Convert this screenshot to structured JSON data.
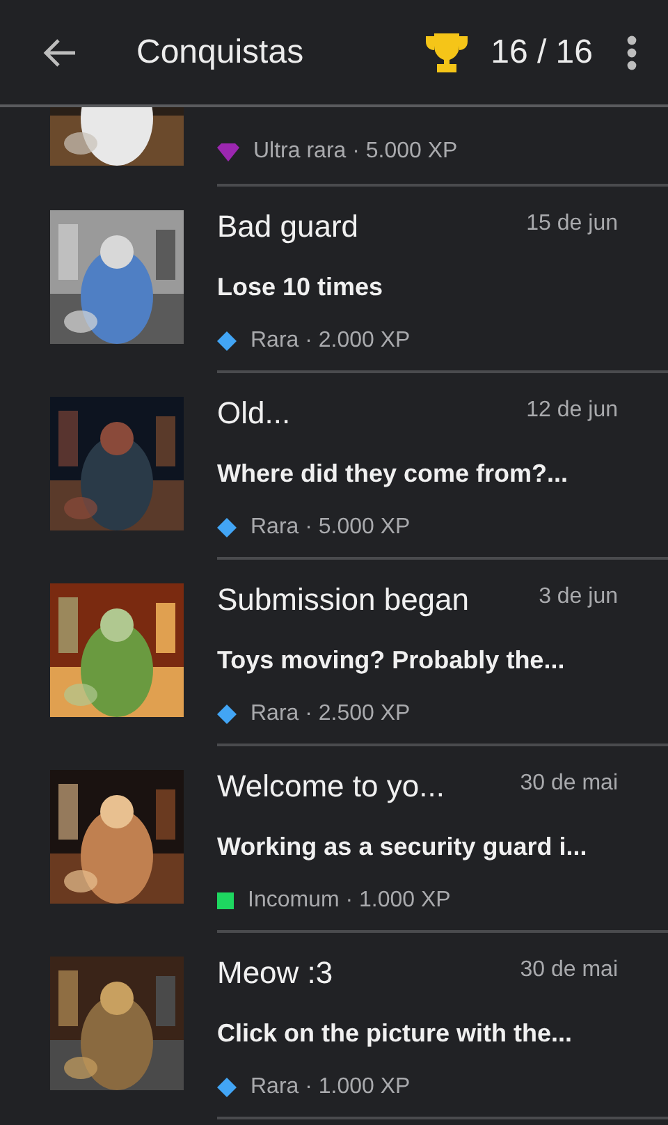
{
  "header": {
    "title": "Conquistas",
    "count": "16 / 16"
  },
  "achievements": [
    {
      "partial": true,
      "rarity": {
        "kind": "gem",
        "color": "#9c27b0",
        "label": "Ultra rara · 5.000 XP"
      }
    },
    {
      "title": "Bad guard",
      "date": "15 de jun",
      "description": "Lose 10 times",
      "rarity": {
        "kind": "diamond",
        "color": "#42a5f5",
        "label": "Rara · 2.000 XP"
      }
    },
    {
      "title": "Old...",
      "date": "12 de jun",
      "description": "Where did they come from?...",
      "rarity": {
        "kind": "diamond",
        "color": "#42a5f5",
        "label": "Rara · 5.000 XP"
      }
    },
    {
      "title": "Submission began",
      "date": "3 de jun",
      "description": "Toys moving? Probably the...",
      "rarity": {
        "kind": "diamond",
        "color": "#42a5f5",
        "label": "Rara · 2.500 XP"
      }
    },
    {
      "title": "Welcome to yo...",
      "date": "30 de mai",
      "description": "Working as a security guard i...",
      "rarity": {
        "kind": "square",
        "color": "#1ed760",
        "label": "Incomum · 1.000 XP"
      }
    },
    {
      "title": "Meow :3",
      "date": "30 de mai",
      "description": "Click on the picture with the...",
      "rarity": {
        "kind": "diamond",
        "color": "#42a5f5",
        "label": "Rara · 1.000 XP"
      }
    }
  ]
}
